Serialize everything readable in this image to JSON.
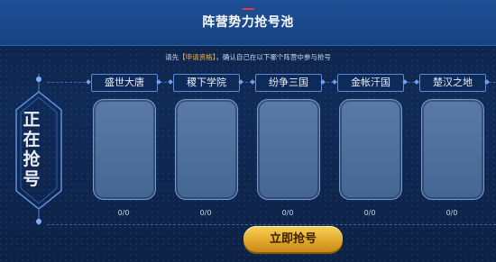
{
  "header": {
    "title": "阵营势力抢号池"
  },
  "notice": {
    "before": "请先",
    "link": "【申请资格】",
    "after": "，确认自己在以下哪个阵营中参与抢号"
  },
  "status_label": [
    "正",
    "在",
    "抢",
    "号"
  ],
  "camps": [
    {
      "name": "盛世大唐",
      "count": "0/0"
    },
    {
      "name": "稷下学院",
      "count": "0/0"
    },
    {
      "name": "纷争三国",
      "count": "0/0"
    },
    {
      "name": "金帐汗国",
      "count": "0/0"
    },
    {
      "name": "楚汉之地",
      "count": "0/0"
    }
  ],
  "action": {
    "grab_button": "立即抢号"
  },
  "colors": {
    "header": "#1f4f96",
    "accent": "#e03a3a",
    "link": "#f2b43a",
    "button": "#e0a52a"
  }
}
